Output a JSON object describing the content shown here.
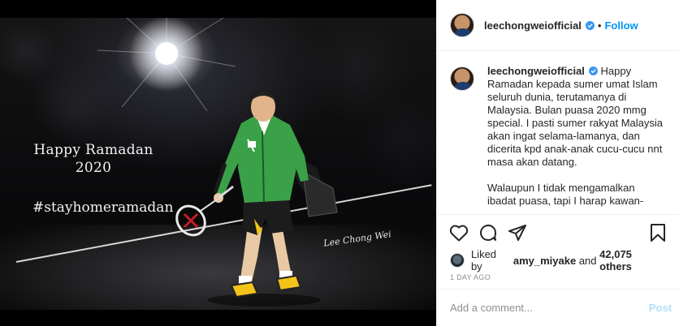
{
  "post": {
    "photo": {
      "greeting_line1": "Happy Ramadan",
      "greeting_line2": "2020",
      "hashtag": "#stayhomeramadan",
      "signature": "Lee Chong Wei"
    }
  },
  "header": {
    "username": "leechongweiofficial",
    "separator": "•",
    "follow_label": "Follow"
  },
  "caption": {
    "username": "leechongweiofficial",
    "paragraph1": "Happy Ramadan kepada sumer umat Islam seluruh dunia, terutamanya di Malaysia. Bulan puasa 2020 mmg special. I pasti sumer rakyat Malaysia akan ingat selama-lamanya, dan dicerita kpd anak-anak cucu-cucu nnt masa akan datang.",
    "paragraph2": "Walaupun I tidak mengamalkan ibadat puasa, tapi I harap kawan-"
  },
  "actions": {
    "like_icon": "heart-icon",
    "comment_icon": "comment-icon",
    "share_icon": "share-icon",
    "save_icon": "bookmark-icon"
  },
  "likes": {
    "prefix": "Liked by",
    "user": "amy_miyake",
    "middle": "and",
    "count": "42,075 others"
  },
  "timestamp": "1 DAY AGO",
  "comment": {
    "placeholder": "Add a comment...",
    "post_label": "Post"
  },
  "colors": {
    "accent": "#0095f6",
    "post_disabled": "#b2dffc",
    "verified_badge": "#3897f0"
  }
}
